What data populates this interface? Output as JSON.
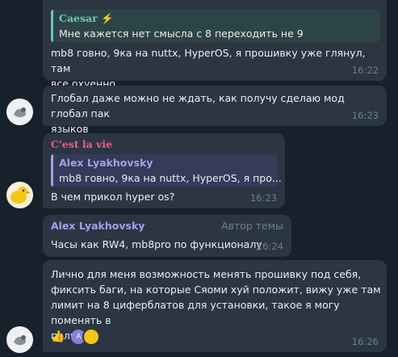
{
  "colors": {
    "background": "#17212b",
    "bubble": "#2b3642",
    "time": "#6d7f8f",
    "quote_green": "#6ec6be",
    "quote_purple": "#a99ee8",
    "sender_pink": "#f05b8c",
    "sender_purple": "#a99ee8"
  },
  "messages": [
    {
      "quote": {
        "name": "Caesar ⚡",
        "text": "Мне кажется нет смысла с 8 переходить не 9"
      },
      "lines": [
        "mb8 говно, 9ка на nuttx, HyperOS, я прошивку уже глянул, там",
        "все охуенно"
      ],
      "time": "16:22"
    },
    {
      "avatar": "avatar-icon",
      "lines": [
        "Глобал даже можно не ждать, как получу сделаю мод глобал пак",
        "языков"
      ],
      "time": "16:23"
    },
    {
      "sender": "C'est la vie",
      "quote": {
        "name": "Alex Lyakhovsky",
        "text": "mb8 говно, 9ка на nuttx, HyperOS, я про..."
      },
      "lines": [
        "В чем прикол hyper os?"
      ],
      "time": "16:23",
      "avatar": "duck-avatar-icon"
    },
    {
      "sender": "Alex Lyakhovsky",
      "role": "Автор темы",
      "lines": [
        "Часы как RW4, mb8pro по функционалу"
      ],
      "time": "16:24"
    },
    {
      "lines": [
        "Лично для меня возможность менять прошивку под себя,",
        "фиксить баги, на которые Сяоми хуй положит, вижу уже там",
        "лимит на 8 циферблатов для установки, такое я могу поменять в",
        "полчаса"
      ],
      "time": "16:26",
      "reaction": {
        "emoji": "👍",
        "icon": "thumbs-up-icon"
      },
      "avatar": "avatar-icon"
    }
  ]
}
